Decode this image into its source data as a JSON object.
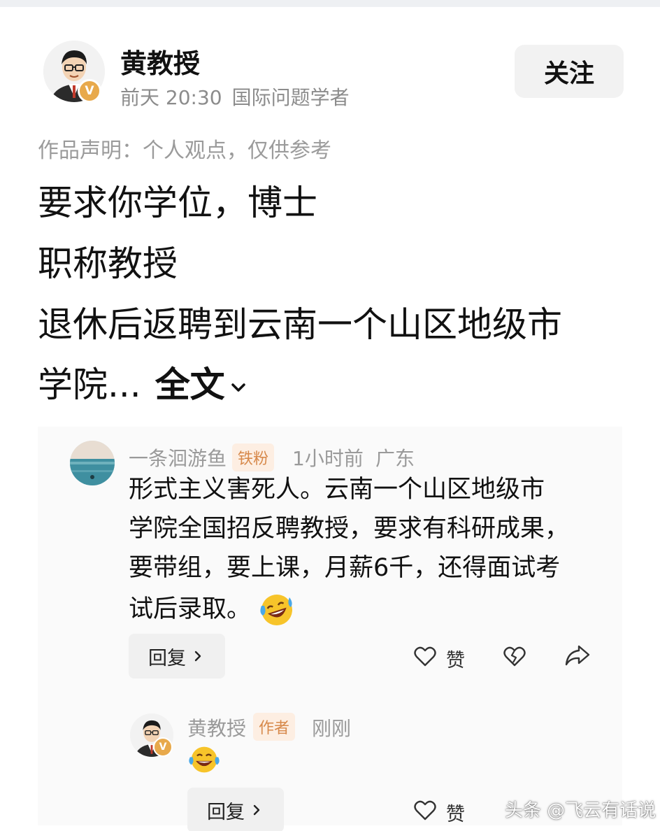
{
  "post": {
    "author_name": "黄教授",
    "verified_badge": "V",
    "time": "前天 20:30",
    "author_title": "国际问题学者",
    "follow_label": "关注",
    "disclaimer": "作品声明：个人观点，仅供参考",
    "lines": [
      "要求你学位，博士",
      "职称教授",
      "退休后返聘到云南一个山区地级市",
      "学院..."
    ],
    "expand_label": "全文"
  },
  "comment": {
    "user_name": "一条洄游鱼",
    "badge": "铁粉",
    "time": "1小时前",
    "location": "广东",
    "lines": [
      "形式主义害死人。云南一个山区地级市",
      "学院全国招反聘教授，要求有科研成果，",
      "要带组，要上课，月薪6千，还得面试考",
      "试后录取。"
    ],
    "reply_label": "回复",
    "like_label": "赞",
    "icons": [
      "like-icon",
      "dislike-icon",
      "share-icon"
    ]
  },
  "reply": {
    "user_name": "黄教授",
    "badge": "作者",
    "time": "刚刚",
    "reply_label": "回复",
    "like_label": "赞"
  },
  "watermark": "头条 @飞云有话说",
  "colors": {
    "badge_bg": "#fdeee2",
    "badge_text": "#d7894b",
    "verified": "#e8a94b",
    "meta_gray": "#9a9a9a"
  }
}
